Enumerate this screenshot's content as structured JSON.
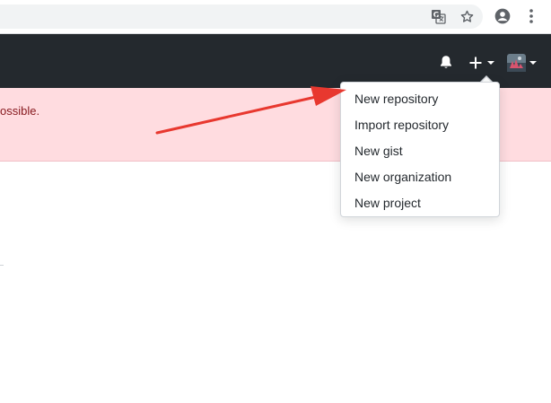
{
  "flash": {
    "message": "ossible."
  },
  "new_menu": {
    "items": [
      {
        "label": "New repository"
      },
      {
        "label": "Import repository"
      },
      {
        "label": "New gist"
      },
      {
        "label": "New organization"
      },
      {
        "label": "New project"
      }
    ]
  },
  "icons": {
    "translate": "translate-icon",
    "bookmark": "star-icon",
    "profile": "account-circle-icon",
    "menu": "more-vertical-icon",
    "notifications": "bell-icon",
    "create": "plus-icon",
    "avatar": "avatar"
  },
  "colors": {
    "header_bg": "#24292e",
    "flash_bg": "#ffdce0",
    "flash_text": "#86181d",
    "annotation_arrow": "#e8382f"
  }
}
